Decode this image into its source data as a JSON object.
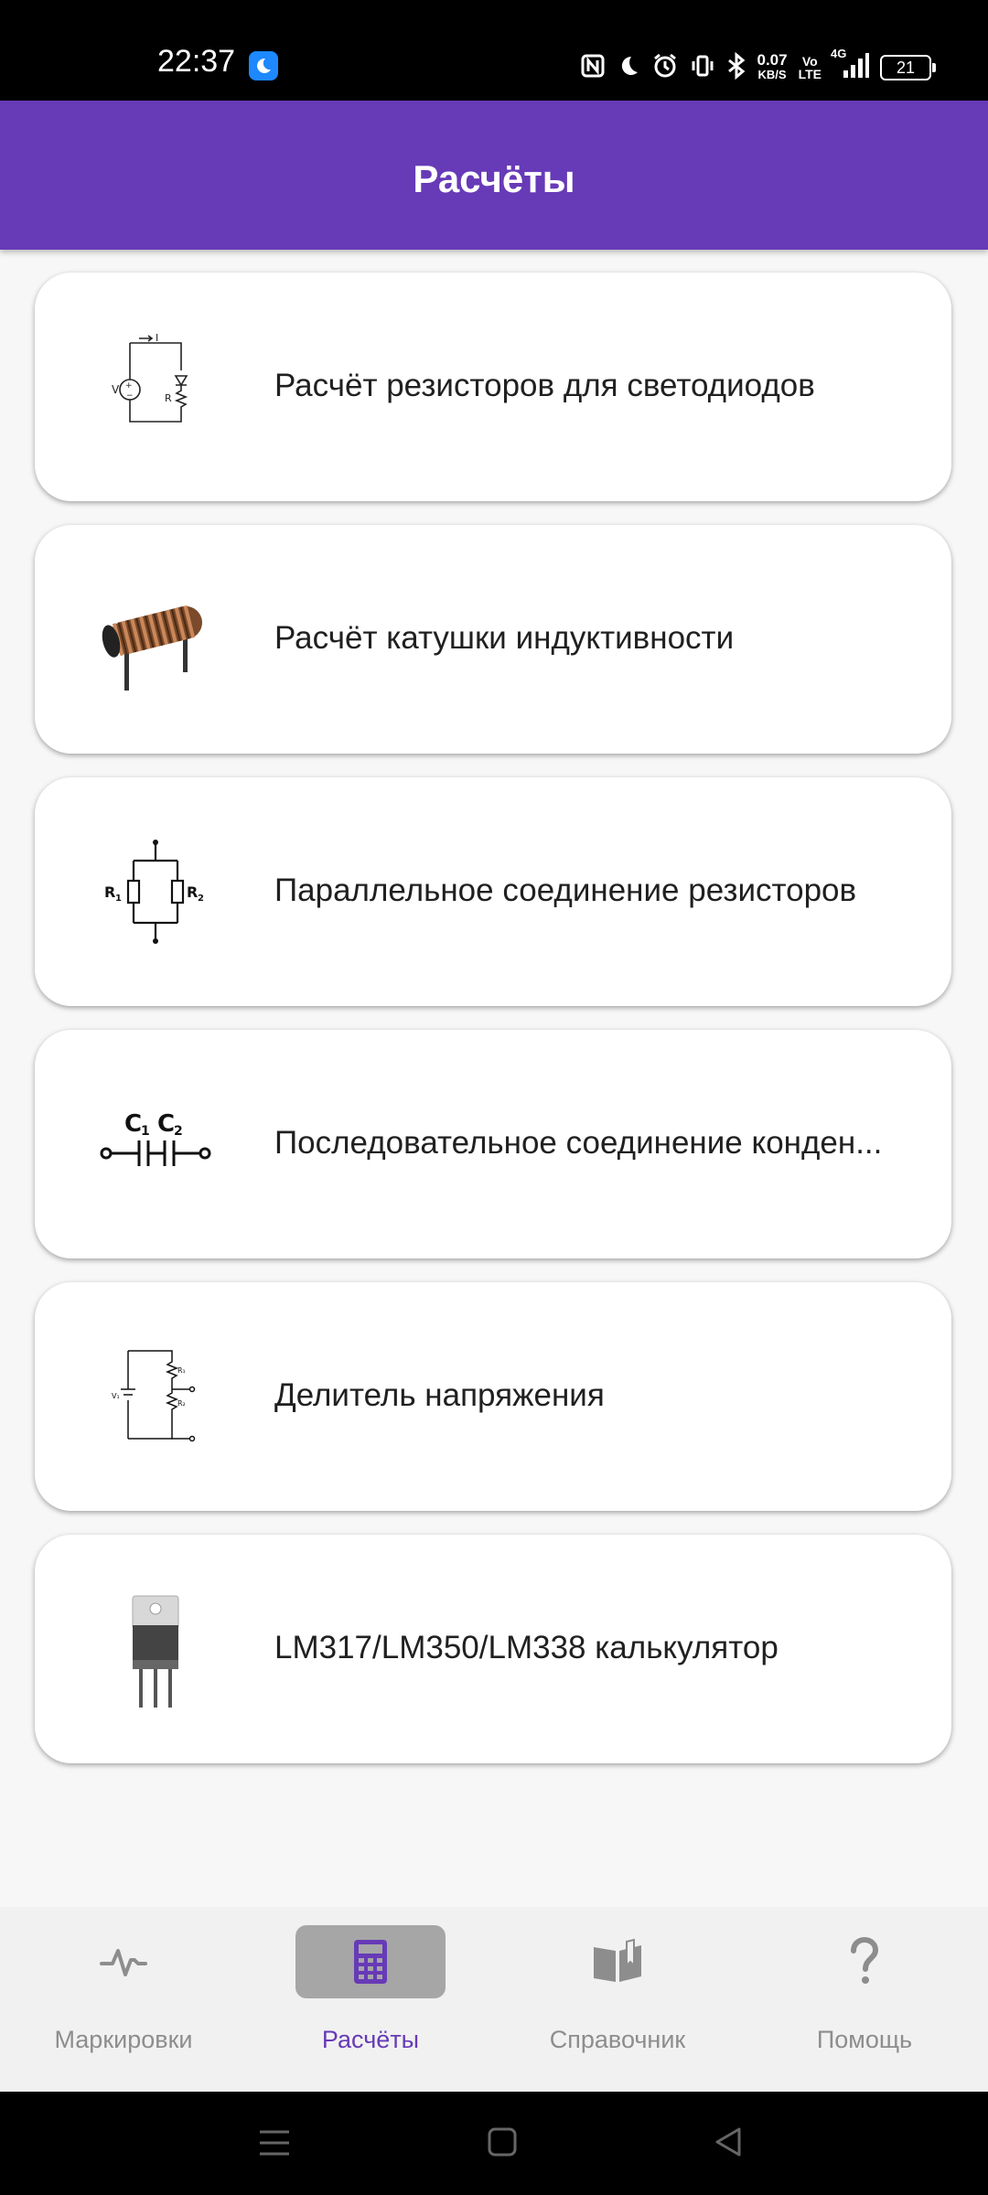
{
  "status_bar": {
    "time": "22:37",
    "speed_value": "0.07",
    "speed_unit": "KB/S",
    "volte_top": "Vo",
    "volte_bottom": "LTE",
    "network": "4G",
    "battery": "21"
  },
  "app_bar": {
    "title": "Расчёты"
  },
  "cards": [
    {
      "label": "Расчёт резисторов для светодиодов",
      "icon": "led-resistor-circuit-icon"
    },
    {
      "label": "Расчёт катушки индуктивности",
      "icon": "inductor-coil-icon"
    },
    {
      "label": "Параллельное соединение резисторов",
      "icon": "parallel-resistors-icon"
    },
    {
      "label": "Последовательное соединение конден...",
      "icon": "series-capacitors-icon"
    },
    {
      "label": "Делитель напряжения",
      "icon": "voltage-divider-icon"
    },
    {
      "label": "LM317/LM350/LM338 калькулятор",
      "icon": "voltage-regulator-icon"
    }
  ],
  "icon_text": {
    "r1": "R",
    "r1_sub": "1",
    "r2": "R",
    "r2_sub": "2",
    "c1": "C",
    "c1_sub": "1",
    "c2": "C",
    "c2_sub": "2",
    "v": "V",
    "r": "R",
    "i": "I"
  },
  "bottom_nav": {
    "items": [
      {
        "label": "Маркировки",
        "icon": "pulse-icon",
        "active": false
      },
      {
        "label": "Расчёты",
        "icon": "calculator-icon",
        "active": true
      },
      {
        "label": "Справочник",
        "icon": "book-icon",
        "active": false
      },
      {
        "label": "Помощь",
        "icon": "help-icon",
        "active": false
      }
    ]
  },
  "colors": {
    "primary": "#673ab7",
    "inactive": "#8d8d8d",
    "active_pill": "#a6a6a6"
  }
}
